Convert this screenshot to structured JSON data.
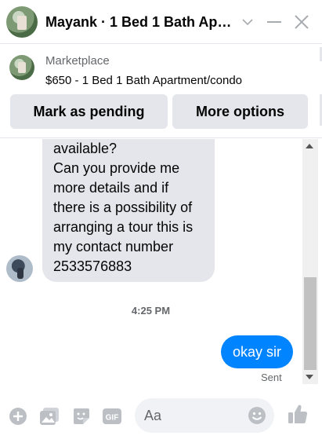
{
  "header": {
    "title": "Mayank · 1 Bed 1 Bath Apa..."
  },
  "marketplace": {
    "label": "Marketplace",
    "listing_title": "$650 - 1 Bed 1 Bath Apartment/condo",
    "buttons": {
      "mark_pending": "Mark as pending",
      "more_options": "More options"
    }
  },
  "messages": {
    "incoming_text": "available?\nCan you provide me\nmore details and if\nthere is a possibility of\narranging a tour this is\nmy contact number\n2533576883",
    "timestamp": "4:25 PM",
    "outgoing_text": "okay sir",
    "outgoing_status": "Sent"
  },
  "composer": {
    "placeholder": "Aa",
    "gif_label": "GIF"
  },
  "colors": {
    "accent": "#0084ff",
    "icon_gray": "#bcc0c4",
    "bubble_gray": "#e4e6eb"
  }
}
